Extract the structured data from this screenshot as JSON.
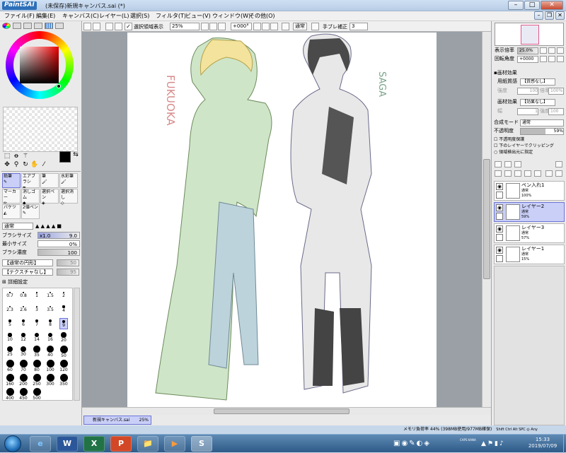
{
  "app": {
    "logo": "SAI",
    "title": "(未保存)新規キャンバス.sai (*)"
  },
  "window_controls": {
    "minimize": "–",
    "maximize": "□",
    "close": "✕",
    "inner_minimize": "–",
    "inner_restore": "❐",
    "inner_close": "✕"
  },
  "menu": {
    "items": [
      "ファイル(F)",
      "編集(E)",
      "キャンバス(C)",
      "レイヤー(L)",
      "選択(S)",
      "フィルタ(T)",
      "ビュー(V)",
      "ウィンドウ(W)",
      "その他(O)"
    ]
  },
  "toolbar": {
    "selection_visible_label": "選択領域表示",
    "zoom": "25%",
    "rotation": "+000°",
    "blend": "通常",
    "stabilizer_label": "手ブレ補正",
    "stabilizer_value": "3"
  },
  "tools": {
    "brushes": [
      {
        "label": "鉛筆",
        "selected": true
      },
      {
        "label": "エアブラシ",
        "selected": false
      },
      {
        "label": "筆",
        "selected": false
      },
      {
        "label": "水彩筆",
        "selected": false
      },
      {
        "label": "マーカー",
        "selected": false
      },
      {
        "label": "消しゴム",
        "selected": false
      },
      {
        "label": "選択ペン",
        "selected": false
      },
      {
        "label": "選択消し",
        "selected": false
      },
      {
        "label": "バケツ",
        "selected": false
      },
      {
        "label": "2値ペン",
        "selected": false
      }
    ],
    "mode": "通常",
    "brush_size_label": "ブラシサイズ",
    "brush_size_mult": "x1.0",
    "brush_size_value": "9.0",
    "min_size_label": "最小サイズ",
    "min_size_value": "0%",
    "density_label": "ブラシ濃度",
    "density_value": "100",
    "shape_dropdown": "【通常の円形】",
    "shape_value": "50",
    "texture_dropdown": "【テクスチャなし】",
    "texture_value": "95",
    "detail_settings": "詳細設定",
    "brush_sizes": [
      "0.7",
      "0.8",
      "1",
      "1.5",
      "2",
      "2.3",
      "2.6",
      "3",
      "3.5",
      "4",
      "5",
      "6",
      "7",
      "8",
      "9",
      "10",
      "12",
      "14",
      "16",
      "20",
      "25",
      "30",
      "35",
      "40",
      "50",
      "60",
      "70",
      "80",
      "100",
      "120",
      "160",
      "200",
      "250",
      "300",
      "350",
      "400",
      "450",
      "500"
    ]
  },
  "navigator": {
    "zoom_label": "表示倍率",
    "zoom_value": "25.0%",
    "angle_label": "回転角度",
    "angle_value": "+0000"
  },
  "paper": {
    "header": "画材効果",
    "texture_label": "用紙質感",
    "texture_value": "【質感なし】",
    "strength_label": "強度",
    "strength_value": "100",
    "scale_label": "倍率",
    "scale_value": "100%",
    "effect_label": "画材効果",
    "effect_value": "【効果なし】",
    "width_label": "幅",
    "width_value": "1",
    "strength2_label": "強度",
    "strength2_value": "100"
  },
  "layer_props": {
    "blend_label": "合成モード",
    "blend_value": "通常",
    "opacity_label": "不透明度",
    "opacity_value": "59%",
    "opacity_fraction": 0.59,
    "protect_alpha": "不透明度保護",
    "clip_below": "下のレイヤーでクリッピング",
    "select_source": "領域検出元に指定"
  },
  "layers": [
    {
      "name": "ペン入れ1",
      "mode": "通常",
      "opacity": "100%",
      "selected": false
    },
    {
      "name": "レイヤー2",
      "mode": "通常",
      "opacity": "59%",
      "selected": true
    },
    {
      "name": "レイヤー3",
      "mode": "通常",
      "opacity": "57%",
      "selected": false
    },
    {
      "name": "レイヤー1",
      "mode": "通常",
      "opacity": "15%",
      "selected": false
    }
  ],
  "canvas": {
    "text_left": "FUKUOKA",
    "text_right": "SAGA"
  },
  "document_tab": {
    "name": "新規キャンバス.sai",
    "zoom": "25%"
  },
  "status": {
    "memory": "メモリ負荷率 44% (398MB使用/977MB確保)",
    "keys": "Shift Ctrl Alt SPC ◎ Any"
  },
  "taskbar": {
    "apps": [
      "e",
      "W",
      "X",
      "P",
      "📁",
      "▶",
      "S"
    ],
    "time": "15:33",
    "date": "2019/07/09",
    "ime": "CAPS KANA"
  },
  "colors": {
    "accent": "#6c74d6",
    "selected_bg": "#c9cff7",
    "foreground": "#000000",
    "background": "#ffffff"
  }
}
